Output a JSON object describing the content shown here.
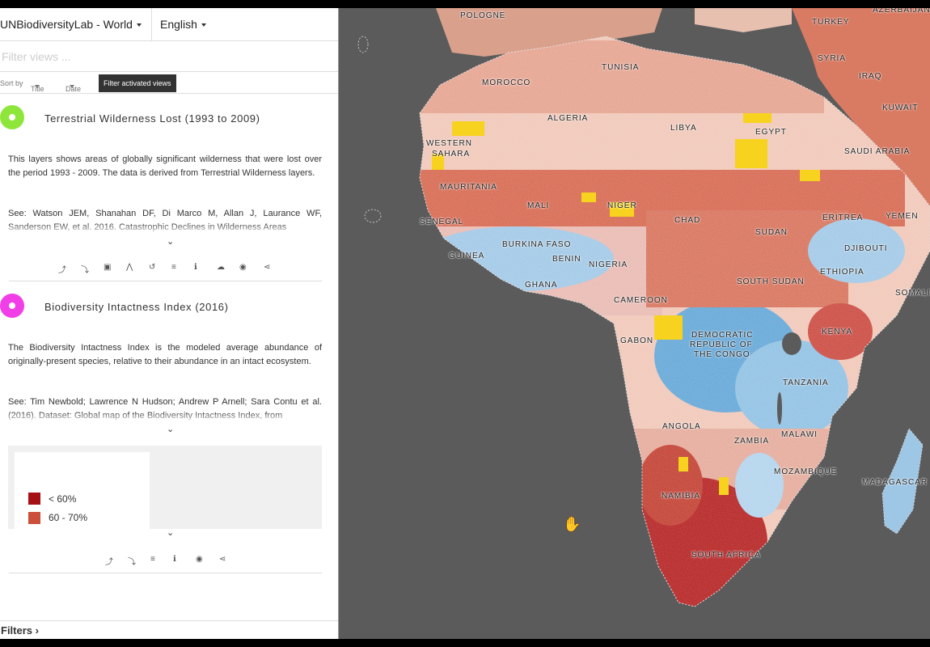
{
  "header": {
    "world_select": "UNBiodiversityLab - World",
    "language_select": "English"
  },
  "filter": {
    "placeholder": "Filter views ..."
  },
  "sort": {
    "label": "Sort by",
    "title": "Title",
    "date": "Date",
    "activated_button": "Filter activated views"
  },
  "layers": [
    {
      "title": "Terrestrial Wilderness Lost (1993 to 2009)",
      "color": "#8ee63a",
      "description": "This layers shows areas of globally significant wilderness that were lost over the period 1993 - 2009. The data is derived from Terrestrial Wilderness layers.",
      "citation": "See: Watson JEM, Shanahan DF, Di Marco M, Allan J, Laurance WF, Sanderson EW, et al. 2016. Catastrophic Declines in Wilderness Areas"
    },
    {
      "title": "Biodiversity Intactness Index (2016)",
      "color": "#f23ee6",
      "description": "The Biodiversity Intactness Index is the modeled average abundance of originally-present species, relative to their abundance in an intact ecosystem.",
      "citation": "See: Tim Newbold; Lawrence N Hudson; Andrew P Arnell; Sara Contu et al. (2016). Dataset: Global map of the Biodiversity Intactness Index, from",
      "legend": [
        {
          "label": "< 60%",
          "color": "#a50f15"
        },
        {
          "label": "60 - 70%",
          "color": "#cb4f3a"
        }
      ]
    }
  ],
  "footer": {
    "filters": "Filters ›"
  },
  "map": {
    "labels": [
      "POLOGNE",
      "TURKEY",
      "AZERBAIJAN",
      "TUNISIA",
      "MOROCCO",
      "SYRIA",
      "IRAQ",
      "ALGERIA",
      "LIBYA",
      "EGYPT",
      "KUWAIT",
      "WESTERN",
      "SAHARA",
      "SAUDI ARABIA",
      "MAURITANIA",
      "MALI",
      "NIGER",
      "CHAD",
      "SUDAN",
      "ERITREA",
      "YEMEN",
      "SENEGAL",
      "BURKINA FASO",
      "GUINEA",
      "BENIN",
      "NIGERIA",
      "DJIBOUTI",
      "ETHIOPIA",
      "SOUTH SUDAN",
      "GHANA",
      "SOMALIA",
      "CAMEROON",
      "GABON",
      "DEMOCRATIC",
      "REPUBLIC OF",
      "THE CONGO",
      "KENYA",
      "TANZANIA",
      "ANGOLA",
      "ZAMBIA",
      "MALAWI",
      "MOZAMBIQUE",
      "MADAGASCAR",
      "NAMIBIA",
      "SOUTH AFRICA"
    ]
  }
}
